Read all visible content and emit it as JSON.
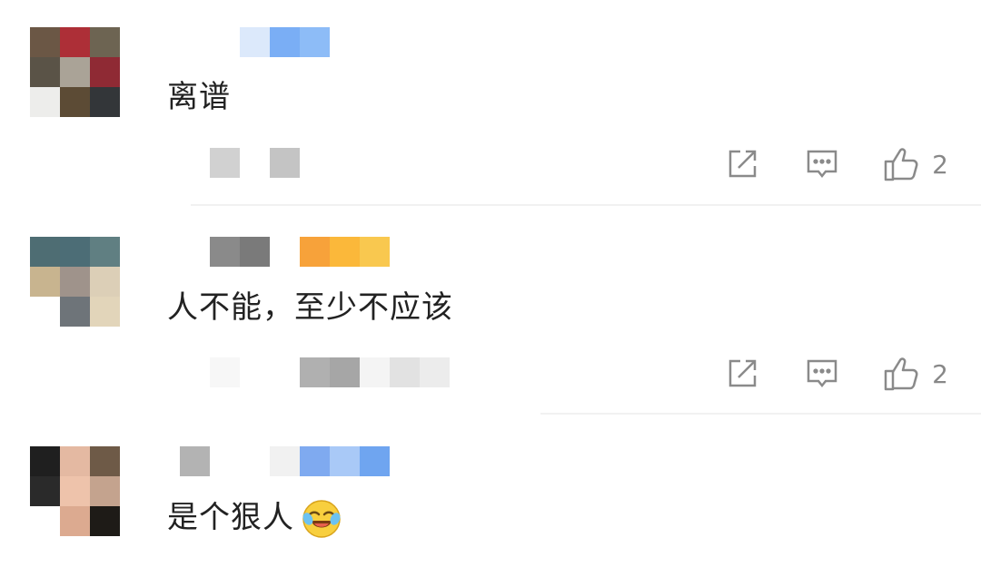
{
  "comments": [
    {
      "text": "离谱",
      "avatar": [
        "#6b5745",
        "#ad2f37",
        "#6d6452",
        "#5a5347",
        "#aaa397",
        "#8f2a34",
        "#ededeb",
        "#5c4b35",
        "#333639"
      ],
      "name_blocks": [
        "#ffffff",
        "#ffffff",
        "#dce9fb",
        "#7aaef5",
        "#8dbcf7"
      ],
      "meta_blocks": [
        "#d1d1d1",
        "#ffffff",
        "#c4c4c4"
      ],
      "like_count": "2"
    },
    {
      "text": "人不能，至少不应该",
      "avatar": [
        "#4e6d73",
        "#4c6d76",
        "#607f82",
        "#c8b48f",
        "#9f938b",
        "#dccfb7",
        "#ffffff",
        "#6e7479",
        "#e2d5ba"
      ],
      "name_blocks": [
        "#8a8a8a",
        "#7a7a7a",
        "#ffffff",
        "#f7a23a",
        "#fbb83a",
        "#f9c84f"
      ],
      "meta_blocks": [
        "#f7f7f7",
        "#ffffff",
        "#ffffff",
        "#b0b0b0",
        "#a6a6a6",
        "#f4f4f4",
        "#e2e2e2",
        "#ececec"
      ],
      "like_count": "2"
    },
    {
      "text": "是个狠人",
      "avatar": [
        "#1f1f1f",
        "#e4b9a2",
        "#6e5a47",
        "#2a2a2a",
        "#eec3ab",
        "#c4a38e",
        "#ffffff",
        "#dcaa90",
        "#1e1b17"
      ],
      "name_blocks": [
        "#b3b3b3",
        "#ffffff",
        "#ffffff",
        "#f1f1f1",
        "#7faaf0",
        "#a9c9f7",
        "#6fa5f0"
      ],
      "meta_blocks": [],
      "like_count": ""
    }
  ],
  "icons": {
    "share": "share-icon",
    "reply": "comment-icon",
    "like": "thumbs-up-icon",
    "emoji": "laugh-cry-emoji-icon"
  }
}
